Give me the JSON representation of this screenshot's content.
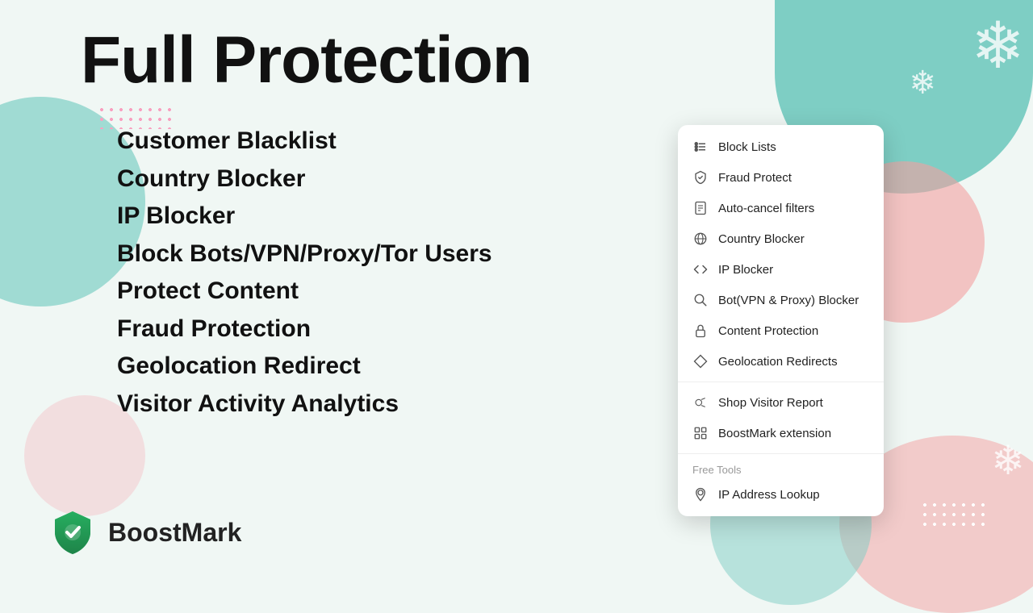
{
  "page": {
    "title": "Full Protection",
    "background_color": "#f0f7f4"
  },
  "features": {
    "bullet": "•",
    "items": [
      {
        "label": "Customer Blacklist"
      },
      {
        "label": "Country Blocker"
      },
      {
        "label": "IP Blocker"
      },
      {
        "label": "Block Bots/VPN/Proxy/Tor Users"
      },
      {
        "label": "Protect Content"
      },
      {
        "label": "Fraud Protection"
      },
      {
        "label": "Geolocation Redirect"
      },
      {
        "label": "Visitor Activity Analytics"
      }
    ]
  },
  "logo": {
    "name": "BoostMark"
  },
  "dropdown": {
    "sections": [
      {
        "items": [
          {
            "id": "block-lists",
            "label": "Block Lists",
            "icon": "list"
          },
          {
            "id": "fraud-protect",
            "label": "Fraud Protect",
            "icon": "shield-check"
          },
          {
            "id": "auto-cancel",
            "label": "Auto-cancel filters",
            "icon": "document"
          },
          {
            "id": "country-blocker",
            "label": "Country Blocker",
            "icon": "globe"
          },
          {
            "id": "ip-blocker",
            "label": "IP Blocker",
            "icon": "code"
          },
          {
            "id": "bot-blocker",
            "label": "Bot(VPN & Proxy) Blocker",
            "icon": "search"
          },
          {
            "id": "content-protection",
            "label": "Content Protection",
            "icon": "lock"
          },
          {
            "id": "geolocation-redirects",
            "label": "Geolocation Redirects",
            "icon": "diamond"
          }
        ]
      },
      {
        "items": [
          {
            "id": "shop-visitor-report",
            "label": "Shop Visitor Report",
            "icon": "report"
          },
          {
            "id": "boostmark-extension",
            "label": "BoostMark extension",
            "icon": "grid"
          }
        ]
      },
      {
        "section_label": "Free Tools",
        "items": [
          {
            "id": "ip-address-lookup",
            "label": "IP Address Lookup",
            "icon": "pin"
          }
        ]
      }
    ]
  },
  "snowflakes": [
    "❄",
    "❄",
    "❄"
  ],
  "decorative": {
    "dots": "..."
  }
}
